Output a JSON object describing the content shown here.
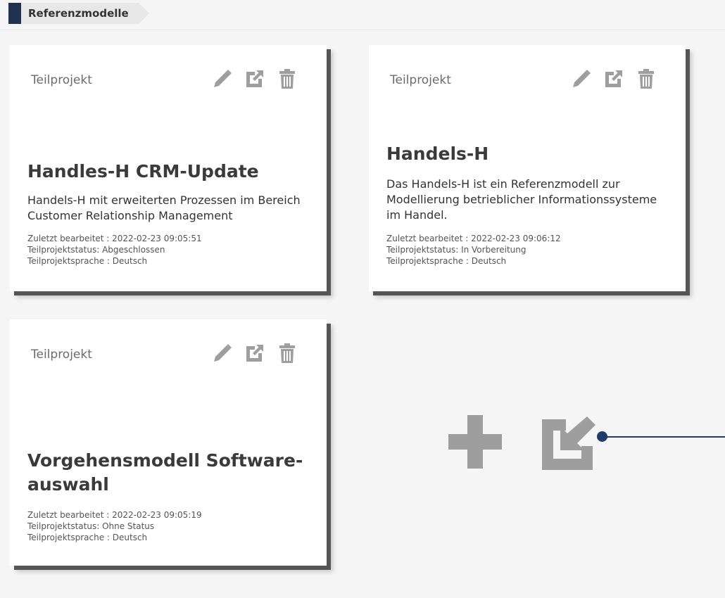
{
  "breadcrumb": {
    "label": "Referenzmodelle"
  },
  "cards": [
    {
      "type": "Teilprojekt",
      "title": "Handles-H CRM-Update",
      "description": "Handels-H mit erweiterten Prozessen im Bereich Customer Relationship Management",
      "last_edited": "Zuletzt bearbeitet : 2022-02-23 09:05:51",
      "status": "Teilprojektstatus: Abgeschlossen",
      "language": "Teilprojektsprache : Deutsch"
    },
    {
      "type": "Teilprojekt",
      "title": "Handels-H",
      "description": "Das Handels-H ist ein Referenzmodell zur Modellierung betrieblicher Informationssysteme im Handel.",
      "last_edited": "Zuletzt bearbeitet : 2022-02-23 09:06:12",
      "status": "Teilprojektstatus: In Vorbereitung",
      "language": "Teilprojektsprache : Deutsch"
    },
    {
      "type": "Teilprojekt",
      "title": "Vorgehensmodell Software-auswahl",
      "description": "",
      "last_edited": "Zuletzt bearbeitet : 2022-02-23 09:05:19",
      "status": "Teilprojektstatus: Ohne Status",
      "language": "Teilprojektsprache : Deutsch"
    }
  ],
  "icons": {
    "edit": "pencil-icon",
    "open": "external-link-icon",
    "delete": "trash-icon",
    "add": "plus-icon",
    "import": "import-icon"
  },
  "colors": {
    "accent": "#1f3350",
    "pointer": "#1f3d6b",
    "icon_gray": "#9e9e9e",
    "card_shadow": "#555555"
  }
}
